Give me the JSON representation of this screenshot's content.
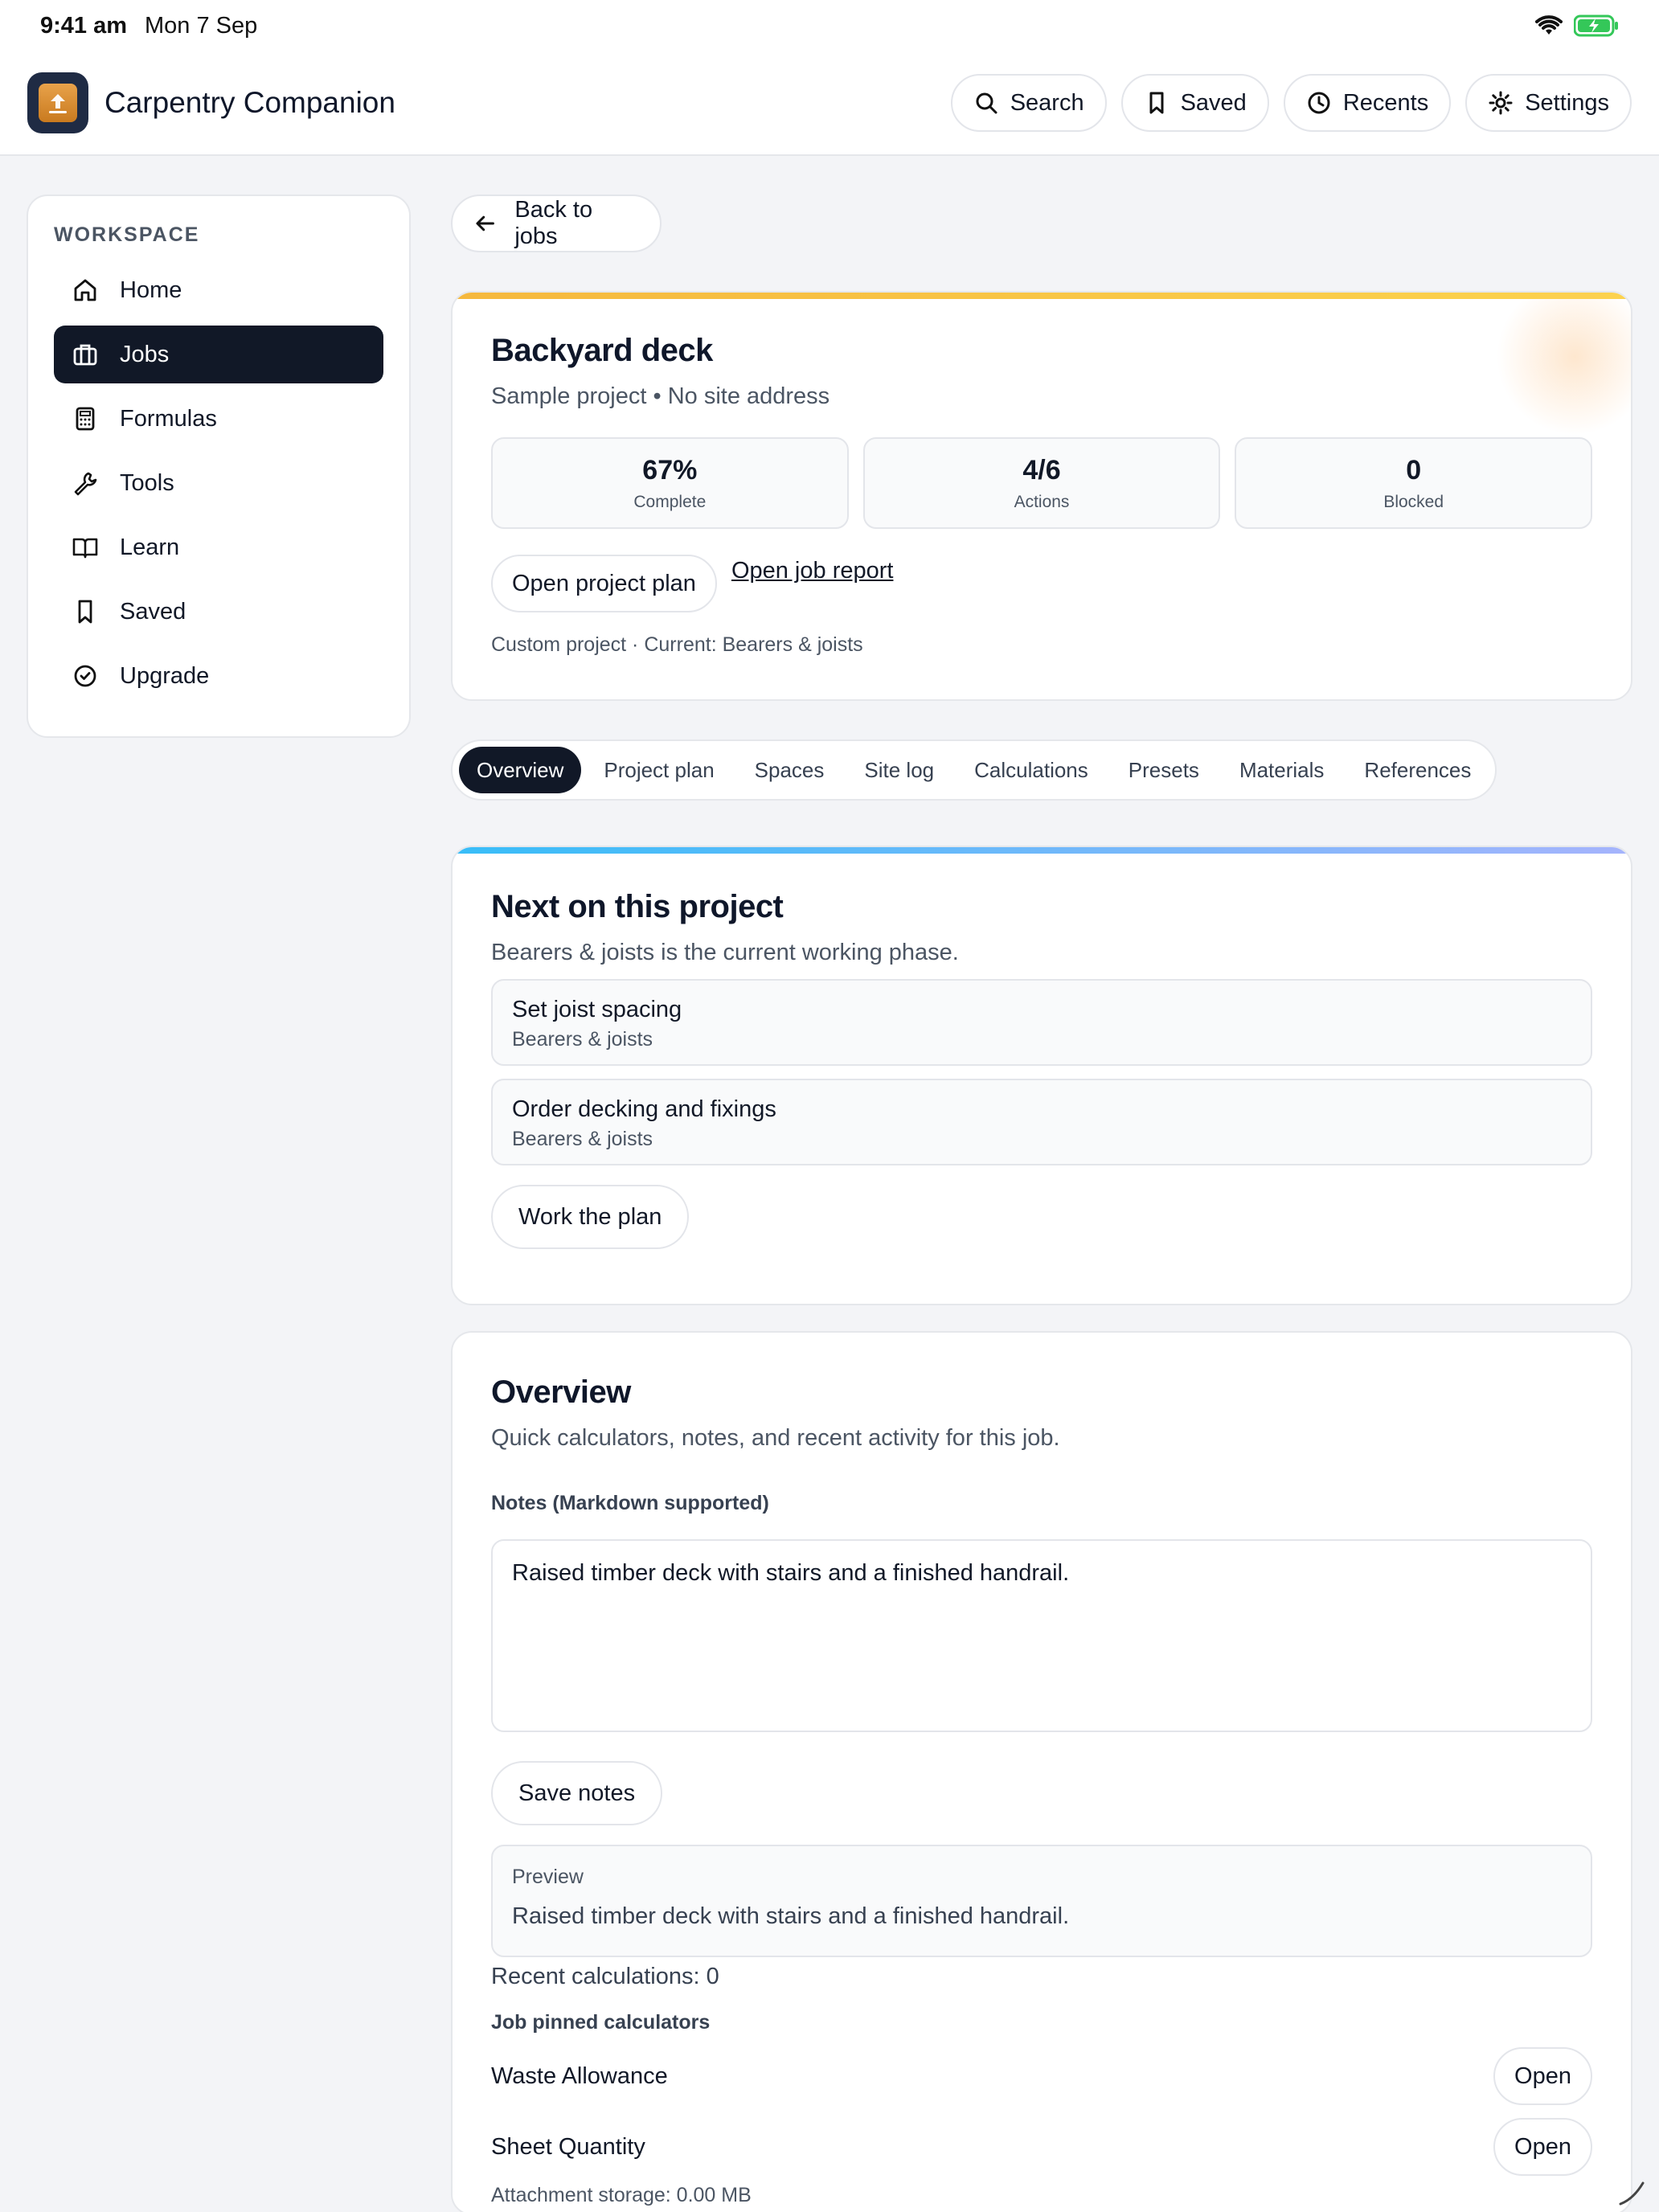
{
  "status_bar": {
    "time": "9:41 am",
    "date": "Mon 7 Sep"
  },
  "app": {
    "title": "Carpentry Companion",
    "icon": "app-logo"
  },
  "top_actions": [
    {
      "label": "Search",
      "icon": "search-icon"
    },
    {
      "label": "Saved",
      "icon": "bookmark-icon"
    },
    {
      "label": "Recents",
      "icon": "clock-icon"
    },
    {
      "label": "Settings",
      "icon": "gear-icon"
    }
  ],
  "sidebar": {
    "heading": "WORKSPACE",
    "items": [
      {
        "label": "Home",
        "icon": "home-icon",
        "active": false
      },
      {
        "label": "Jobs",
        "icon": "briefcase-icon",
        "active": true
      },
      {
        "label": "Formulas",
        "icon": "calculator-icon",
        "active": false
      },
      {
        "label": "Tools",
        "icon": "wrench-icon",
        "active": false
      },
      {
        "label": "Learn",
        "icon": "book-icon",
        "active": false
      },
      {
        "label": "Saved",
        "icon": "bookmark-icon",
        "active": false
      },
      {
        "label": "Upgrade",
        "icon": "badge-check-icon",
        "active": false
      }
    ]
  },
  "back_button": "Back to jobs",
  "job": {
    "title": "Backyard deck",
    "subtitle": "Sample project • No site address",
    "stats": [
      {
        "value": "67%",
        "label": "Complete"
      },
      {
        "value": "4/6",
        "label": "Actions"
      },
      {
        "value": "0",
        "label": "Blocked"
      }
    ],
    "open_plan_button": "Open project plan",
    "open_report_link": "Open job report",
    "meta": "Custom project · Current: Bearers & joists"
  },
  "tabs": [
    "Overview",
    "Project plan",
    "Spaces",
    "Site log",
    "Calculations",
    "Presets",
    "Materials",
    "References"
  ],
  "active_tab": "Overview",
  "next": {
    "title": "Next on this project",
    "subtitle": "Bearers & joists is the current working phase.",
    "tasks": [
      {
        "title": "Set joist spacing",
        "phase": "Bearers & joists"
      },
      {
        "title": "Order decking and fixings",
        "phase": "Bearers & joists"
      }
    ],
    "button": "Work the plan"
  },
  "overview": {
    "title": "Overview",
    "subtitle": "Quick calculators, notes, and recent activity for this job.",
    "notes_label": "Notes (Markdown supported)",
    "notes_value": "Raised timber deck with stairs and a finished handrail.",
    "save_button": "Save notes",
    "preview_label": "Preview",
    "preview_text": "Raised timber deck with stairs and a finished handrail.",
    "recent_calculations": "Recent calculations: 0",
    "pinned_label": "Job pinned calculators",
    "pinned": [
      {
        "name": "Waste Allowance",
        "button": "Open"
      },
      {
        "name": "Sheet Quantity",
        "button": "Open"
      }
    ],
    "storage": "Attachment storage: 0.00 MB"
  },
  "colors": {
    "accent_dark": "#111827",
    "job_accent_from": "#f5b83d",
    "job_accent_to": "#fcd34d",
    "next_accent_from": "#38bdf8",
    "next_accent_to": "#a5b4fc",
    "battery": "#34c759"
  }
}
